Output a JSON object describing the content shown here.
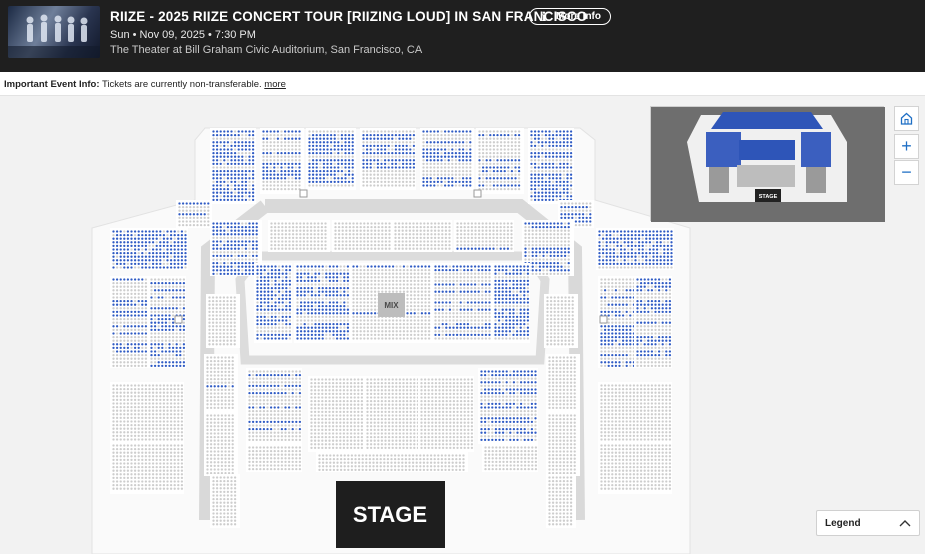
{
  "event": {
    "title": "RIIZE - 2025 RIIZE CONCERT TOUR [RIIZING LOUD] IN SAN FRANCISCO",
    "datetime": "Sun • Nov 09, 2025 • 7:30 PM",
    "venue": "The Theater at Bill Graham Civic Auditorium, San Francisco, CA",
    "more_info_label": "More Info"
  },
  "notice": {
    "label": "Important Event Info:",
    "text": "Tickets are currently non-transferable.",
    "link": "more"
  },
  "seatmap": {
    "stage_label": "STAGE",
    "mix_label": "MIX",
    "available_color": "#2f5bc4",
    "unavailable_color": "#cdcdcd"
  },
  "minimap": {
    "stage_label": "STAGE"
  },
  "controls": {
    "home_icon": "home-icon",
    "zoom_in_icon": "plus-icon",
    "zoom_out_icon": "minus-icon"
  },
  "legend": {
    "label": "Legend"
  }
}
